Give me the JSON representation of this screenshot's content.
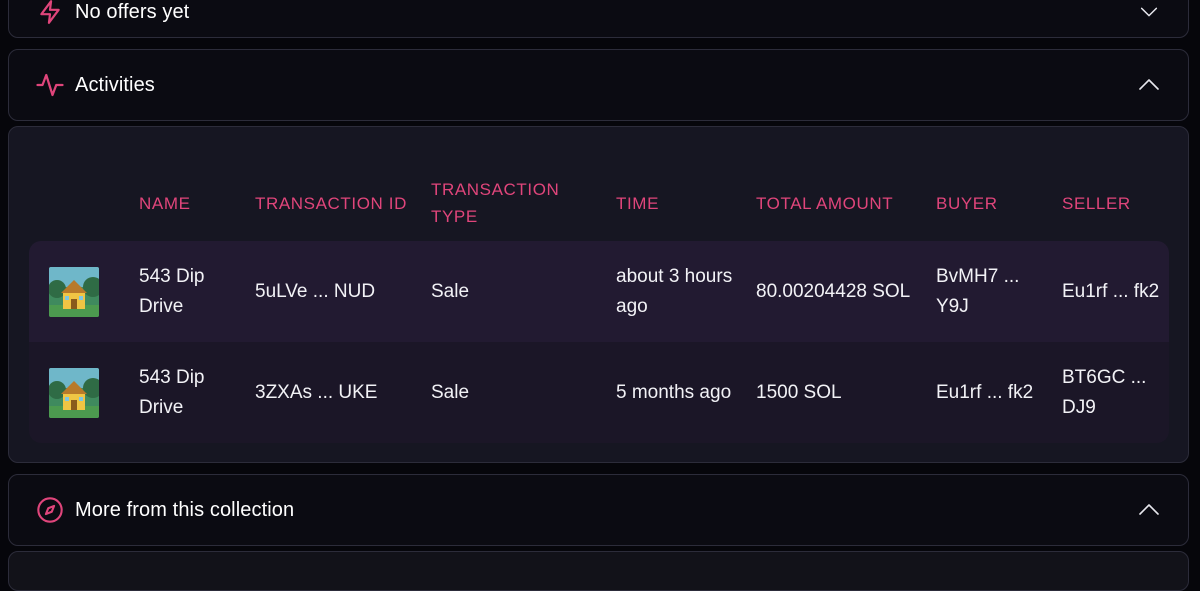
{
  "offers": {
    "title": "No offers yet",
    "icon": "lightning-icon"
  },
  "activities": {
    "title": "Activities",
    "icon": "activity-pulse-icon",
    "columns": [
      "NAME",
      "TRANSACTION ID",
      "TRANSACTION TYPE",
      "TIME",
      "TOTAL AMOUNT",
      "BUYER",
      "SELLER"
    ],
    "rows": [
      {
        "name": "543 Dip Drive",
        "transaction_id": "5uLVe ... NUD",
        "type": "Sale",
        "time": "about 3 hours ago",
        "amount": "80.00204428 SOL",
        "buyer": "BvMH7 ... Y9J",
        "seller": "Eu1rf ... fk2"
      },
      {
        "name": "543 Dip Drive",
        "transaction_id": "3ZXAs ... UKE",
        "type": "Sale",
        "time": "5 months ago",
        "amount": "1500 SOL",
        "buyer": "Eu1rf ... fk2",
        "seller": "BT6GC ... DJ9"
      }
    ]
  },
  "more": {
    "title": "More from this collection",
    "icon": "compass-icon"
  },
  "colors": {
    "accent": "#e0457b",
    "sale": "#52c47a",
    "background": "#06060b",
    "panel": "#0b0b12"
  }
}
